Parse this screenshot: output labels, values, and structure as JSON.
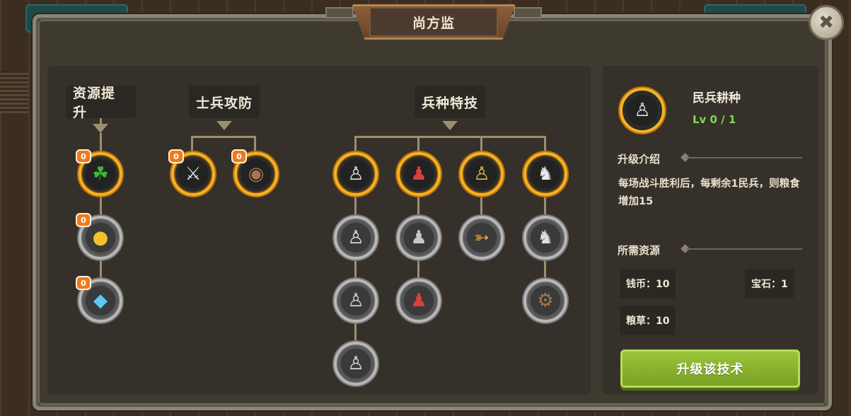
{
  "title": "尚方监",
  "close_icon": "✖",
  "categories": [
    {
      "label": "资源提升"
    },
    {
      "label": "士兵攻防"
    },
    {
      "label": "兵种特技"
    }
  ],
  "badge_value": "0",
  "nodes": {
    "resource": [
      {
        "icon": "clover-icon",
        "glyph": "☘",
        "badge": "0"
      },
      {
        "icon": "gold-coin-icon",
        "glyph": "●",
        "badge": "0"
      },
      {
        "icon": "diamond-icon",
        "glyph": "◆",
        "badge": "0"
      }
    ],
    "attack_defense": [
      {
        "icon": "sword-icon",
        "glyph": "⚔",
        "badge": "0"
      },
      {
        "icon": "shield-icon",
        "glyph": "◉",
        "badge": "0"
      }
    ],
    "unit_skill": [
      {
        "icon": "militia-farmer-icon",
        "glyph": "♙"
      },
      {
        "icon": "red-soldier-icon",
        "glyph": "♟"
      },
      {
        "icon": "archer-icon",
        "glyph": "♙"
      },
      {
        "icon": "cavalry-icon",
        "glyph": "♞"
      },
      {
        "icon": "swordsman-icon",
        "glyph": "♙"
      },
      {
        "icon": "armored-soldier-icon",
        "glyph": "♟"
      },
      {
        "icon": "fire-arrow-icon",
        "glyph": "➳"
      },
      {
        "icon": "horse-rider-icon",
        "glyph": "♞"
      },
      {
        "icon": "helmet-knight-icon",
        "glyph": "♙"
      },
      {
        "icon": "red-brute-icon",
        "glyph": "♟"
      },
      {
        "icon": "siege-cart-icon",
        "glyph": "⚙"
      },
      {
        "icon": "shield-knight-icon",
        "glyph": "♙"
      }
    ]
  },
  "detail": {
    "name": "民兵耕种",
    "level": "Lv 0 / 1",
    "intro_label": "升级介绍",
    "description": "每场战斗胜利后，每剩余1民兵，则粮食增加15",
    "resources_label": "所需资源",
    "resources": [
      {
        "label": "钱币：10"
      },
      {
        "label": "宝石：1"
      },
      {
        "label": "粮草：10"
      }
    ],
    "upgrade_button": "升级该技术"
  },
  "colors": {
    "active_ring": "#f2b521",
    "locked_ring": "#b8b8b8",
    "badge": "#f07a1c",
    "level_text": "#7ed957",
    "upgrade_button": "#8bb52e"
  }
}
